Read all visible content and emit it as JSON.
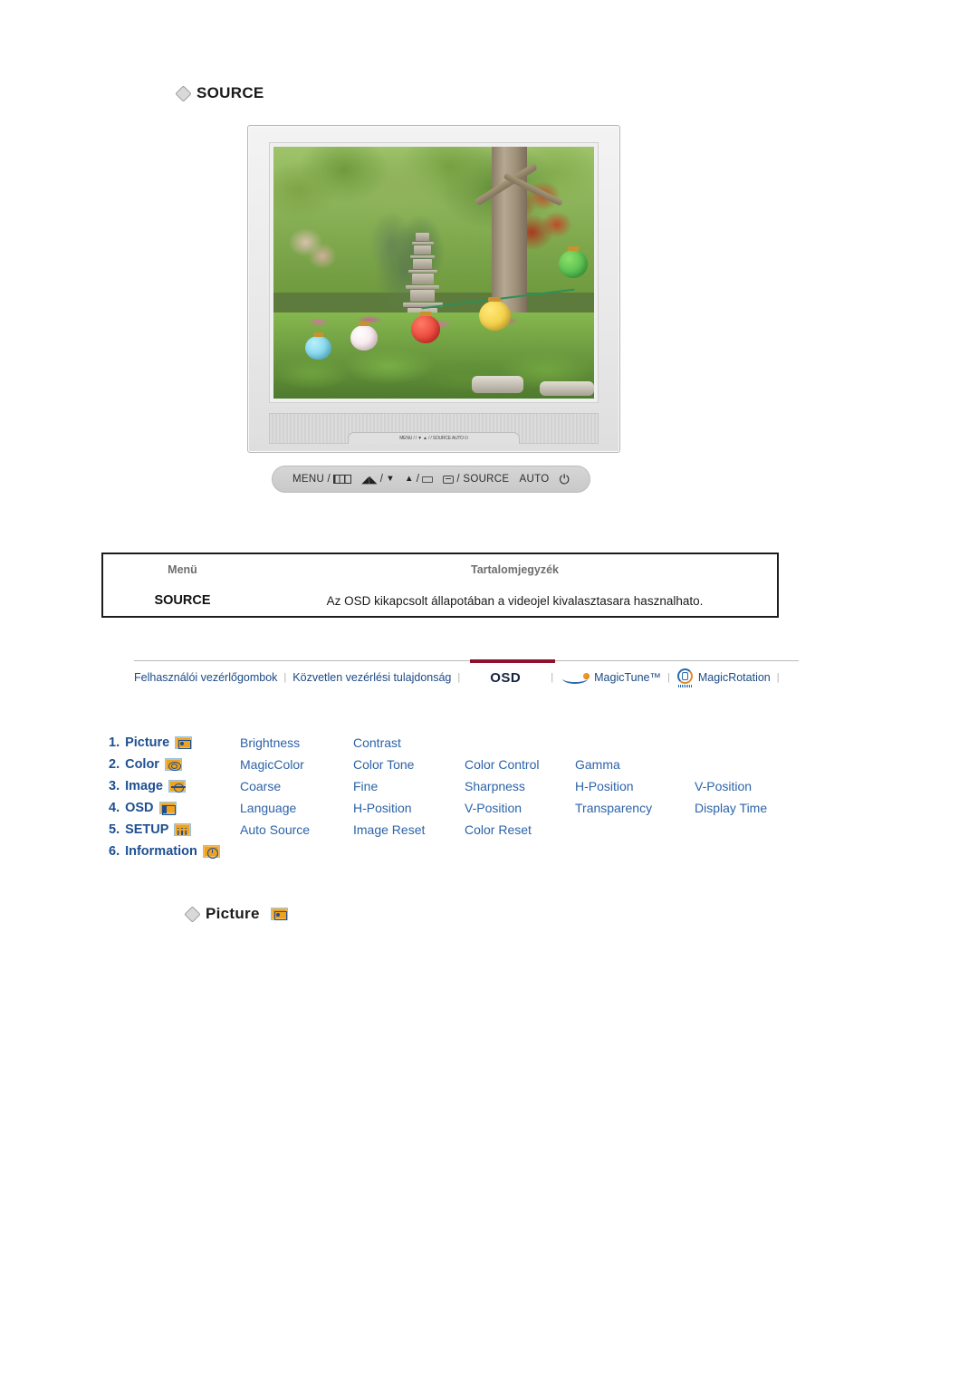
{
  "sections": {
    "source_heading": "SOURCE",
    "picture_heading": "Picture"
  },
  "monitor": {
    "photo_alt": "korean-garden-stone-pagoda-lanterns",
    "button_bar": {
      "menu_label": "MENU /",
      "down_label": "/",
      "down_arrow": "▼",
      "up_arrow": "▲",
      "up_label": "/",
      "source_label": "/ SOURCE",
      "auto_label": "AUTO",
      "power_glyph": "⏻"
    },
    "inline_button_strip": "MENU /       / ▼     ▲ /     / SOURCE    AUTO    ⏻"
  },
  "menu_table": {
    "headers": {
      "menu": "Menü",
      "contents": "Tartalomjegyzék"
    },
    "row": {
      "menu": "SOURCE",
      "contents": "Az OSD kikapcsolt állapotában a videojel kivalasztasara hasznalhato."
    }
  },
  "nav": {
    "items": [
      {
        "label": "Felhasználói vezérlőgombok",
        "active": false
      },
      {
        "label": "Közvetlen vezérlési tulajdonság",
        "active": false
      },
      {
        "label": "OSD",
        "active": true
      },
      {
        "label": "MagicTune™",
        "active": false
      },
      {
        "label": "MagicRotation",
        "active": false
      }
    ],
    "separator": "|",
    "active_color": "#8c1230"
  },
  "osd_menu": {
    "rows": [
      {
        "index": "1.",
        "name": "Picture",
        "icon": "picture-icon",
        "options": [
          "Brightness",
          "Contrast",
          "",
          "",
          ""
        ]
      },
      {
        "index": "2.",
        "name": "Color",
        "icon": "color-icon",
        "options": [
          "MagicColor",
          "Color Tone",
          "Color Control",
          "Gamma",
          ""
        ]
      },
      {
        "index": "3.",
        "name": "Image",
        "icon": "image-icon",
        "options": [
          "Coarse",
          "Fine",
          "Sharpness",
          "H-Position",
          "V-Position"
        ]
      },
      {
        "index": "4.",
        "name": "OSD",
        "icon": "osd-icon",
        "options": [
          "Language",
          "H-Position",
          "V-Position",
          "Transparency",
          "Display Time"
        ]
      },
      {
        "index": "5.",
        "name": "SETUP",
        "icon": "setup-icon",
        "options": [
          "Auto Source",
          "Image Reset",
          "Color Reset",
          "",
          ""
        ]
      },
      {
        "index": "6.",
        "name": "Information",
        "icon": "information-icon",
        "options": [
          "",
          "",
          "",
          "",
          ""
        ]
      }
    ]
  },
  "colors": {
    "link_blue": "#2c63a8",
    "heading_blue": "#1d4f91",
    "icon_orange": "#f0a21e",
    "active_tab_underline": "#8c1230"
  }
}
